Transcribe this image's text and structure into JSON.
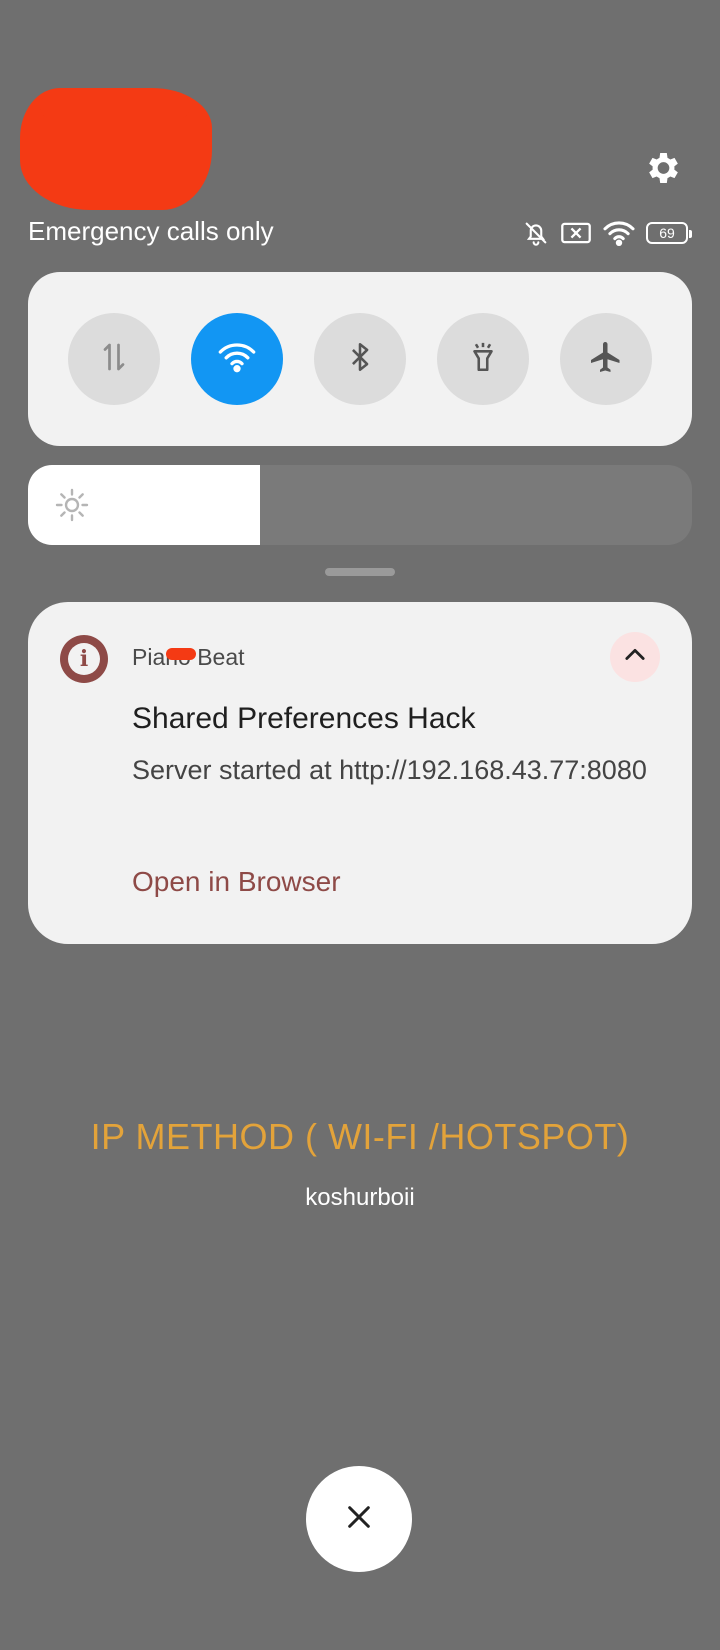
{
  "status_bar": {
    "carrier_text": "Emergency calls only",
    "battery_level": "69",
    "icons": [
      "bell-off-icon",
      "no-sim-icon",
      "wifi-icon",
      "battery-icon"
    ]
  },
  "quick_tiles": [
    {
      "name": "mobile-data",
      "icon": "arrows-up-down-icon",
      "active": false
    },
    {
      "name": "wifi",
      "icon": "wifi-icon",
      "active": true
    },
    {
      "name": "bluetooth",
      "icon": "bluetooth-icon",
      "active": false
    },
    {
      "name": "flashlight",
      "icon": "flashlight-icon",
      "active": false
    },
    {
      "name": "airplane-mode",
      "icon": "airplane-icon",
      "active": false
    }
  ],
  "brightness": {
    "level": 0.35
  },
  "notification": {
    "app_name": "Piano Beat",
    "title": "Shared Preferences Hack",
    "text": "Server started at http://192.168.43.77:8080",
    "action_label": "Open in Browser"
  },
  "overlay": {
    "title": "IP METHOD ( WI-FI /HOTSPOT)",
    "subtitle": "koshurboii"
  },
  "colors": {
    "background": "#6f6f6f",
    "accent_blue": "#1296f3",
    "notification_accent": "#8e4a47",
    "overlay_title": "#e3a33a",
    "redaction": "#f43a14"
  }
}
